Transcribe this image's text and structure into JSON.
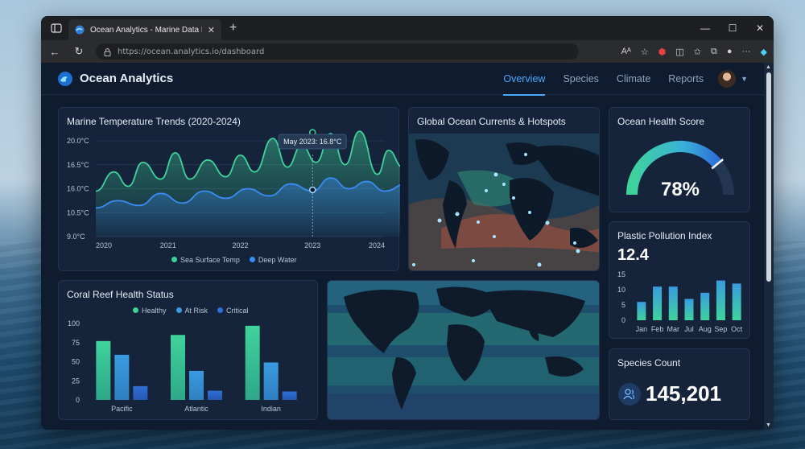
{
  "browser": {
    "tab_title": "Ocean Analytics - Marine Data Dash",
    "url": "https://ocean.analytics.io/dashboard",
    "url_path": "/dashboard",
    "url_host": "https://ocean.analytics.io"
  },
  "header": {
    "brand": "Ocean Analytics",
    "nav": [
      {
        "label": "Overview",
        "active": true
      },
      {
        "label": "Species",
        "active": false
      },
      {
        "label": "Climate",
        "active": false
      },
      {
        "label": "Reports",
        "active": false
      }
    ]
  },
  "temperature_card": {
    "title": "Marine Temperature Trends (2020-2024)",
    "tooltip": "May 2023: 16.8°C",
    "legend": [
      "Sea Surface Temp",
      "Deep Water"
    ]
  },
  "currents_card": {
    "title": "Global Ocean Currents & Hotspots"
  },
  "health_card": {
    "title": "Ocean Health Score",
    "value": "78%",
    "score": 78
  },
  "plastic_card": {
    "title": "Plastic Pollution Index",
    "value": "12.4"
  },
  "coral_card": {
    "title": "Coral Reef Health Status",
    "legend": [
      "Healthy",
      "At Risk",
      "Critical"
    ]
  },
  "species_card": {
    "title": "Species Count",
    "value": "145,201"
  },
  "colors": {
    "healthy": "#3fd39c",
    "at_risk": "#3a9be0",
    "critical": "#2f6fd8",
    "accent": "#4aa8ff"
  },
  "chart_data": [
    {
      "type": "line",
      "title": "Marine Temperature Trends (2020-2024)",
      "x_ticks": [
        "2020",
        "2021",
        "2022",
        "2023",
        "2024"
      ],
      "y_ticks": [
        "9.0°C",
        "10.5°C",
        "16.0°C",
        "16.5°C",
        "20.0°C"
      ],
      "series": [
        {
          "name": "Sea Surface Temp",
          "x": [
            2020.0,
            2020.25,
            2020.45,
            2020.65,
            2020.9,
            2021.1,
            2021.3,
            2021.55,
            2021.8,
            2022.0,
            2022.2,
            2022.45,
            2022.65,
            2022.85,
            2023.05,
            2023.25,
            2023.45,
            2023.65,
            2023.9,
            2024.05,
            2024.25,
            2024.4,
            2024.55,
            2024.7,
            2024.95
          ],
          "values": [
            1.9,
            2.7,
            2.1,
            3.1,
            2.4,
            3.5,
            2.4,
            3.2,
            2.5,
            3.4,
            2.7,
            4.1,
            2.9,
            3.8,
            3.1,
            4.3,
            3.0,
            4.4,
            2.6,
            3.6,
            2.9,
            4.2,
            3.0,
            3.7,
            3.2
          ]
        },
        {
          "name": "Deep Water",
          "x": [
            2020.0,
            2020.3,
            2020.6,
            2020.9,
            2021.2,
            2021.5,
            2021.8,
            2022.1,
            2022.4,
            2022.7,
            2023.0,
            2023.25,
            2023.5,
            2023.75,
            2024.0,
            2024.3,
            2024.6,
            2024.95
          ],
          "values": [
            1.2,
            1.5,
            1.3,
            1.8,
            1.4,
            1.9,
            1.6,
            2.0,
            1.7,
            2.2,
            1.9,
            2.45,
            2.0,
            2.3,
            1.9,
            2.2,
            2.0,
            2.5
          ]
        }
      ],
      "tooltip_point": {
        "x": 2023.0,
        "label": "May 2023: 16.8°C"
      },
      "legend_position": "bottom",
      "grid": true
    },
    {
      "type": "bar",
      "title": "Plastic Pollution Index",
      "categories": [
        "Jan",
        "Feb",
        "Mar",
        "Jul",
        "Aug",
        "Sep",
        "Oct"
      ],
      "values": [
        6,
        11,
        11,
        7,
        9,
        13,
        12
      ],
      "ylim": [
        0,
        15
      ],
      "y_ticks": [
        0,
        5,
        10,
        15
      ]
    },
    {
      "type": "bar",
      "title": "Coral Reef Health Status",
      "categories": [
        "Pacific",
        "Atlantic",
        "Indian"
      ],
      "series": [
        {
          "name": "Healthy",
          "values": [
            77,
            85,
            97
          ]
        },
        {
          "name": "At Risk",
          "values": [
            59,
            38,
            49
          ]
        },
        {
          "name": "Critical",
          "values": [
            18,
            12,
            11
          ]
        }
      ],
      "ylim": [
        0,
        100
      ],
      "y_ticks": [
        0,
        25,
        50,
        75,
        100
      ],
      "legend_position": "top"
    }
  ]
}
